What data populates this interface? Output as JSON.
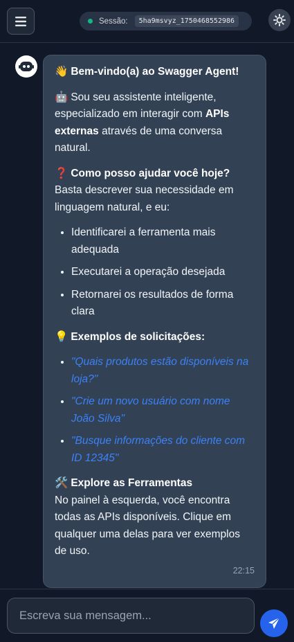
{
  "header": {
    "session_label": "Sessão:",
    "session_id": "5ha9msvyz_1750468552986",
    "status_color": "#10b981",
    "icons": {
      "menu": "hamburger-icon",
      "theme": "sun-icon"
    }
  },
  "message": {
    "avatar_icon": "robot-icon",
    "welcome_emoji": "👋",
    "welcome_title": "Bem-vindo(a) ao Swagger Agent!",
    "intro_emoji": "🤖",
    "intro_text_1": "Sou seu assistente inteligente, especializado em interagir com",
    "intro_bold": "APIs externas",
    "intro_text_2": "através de uma conversa natural.",
    "help_emoji": "❓",
    "help_title": "Como posso ajudar você hoje?",
    "help_text": "Basta descrever sua necessidade em linguagem natural, e eu:",
    "steps": [
      "Identificarei a ferramenta mais adequada",
      "Executarei a operação desejada",
      "Retornarei os resultados de forma clara"
    ],
    "examples_emoji": "💡",
    "examples_title": "Exemplos de solicitações:",
    "examples": [
      "\"Quais produtos estão disponíveis na loja?\"",
      "\"Crie um novo usuário com nome João Silva\"",
      "\"Busque informações do cliente com ID 12345\""
    ],
    "tools_emoji": "🛠️",
    "tools_title": "Explore as Ferramentas",
    "tools_text": "No painel à esquerda, você encontra todas as APIs disponíveis. Clique em qualquer uma delas para ver exemplos de uso.",
    "time": "22:15"
  },
  "composer": {
    "placeholder": "Escreva sua mensagem...",
    "send_icon": "paper-plane-icon",
    "accent": "#2563eb"
  }
}
